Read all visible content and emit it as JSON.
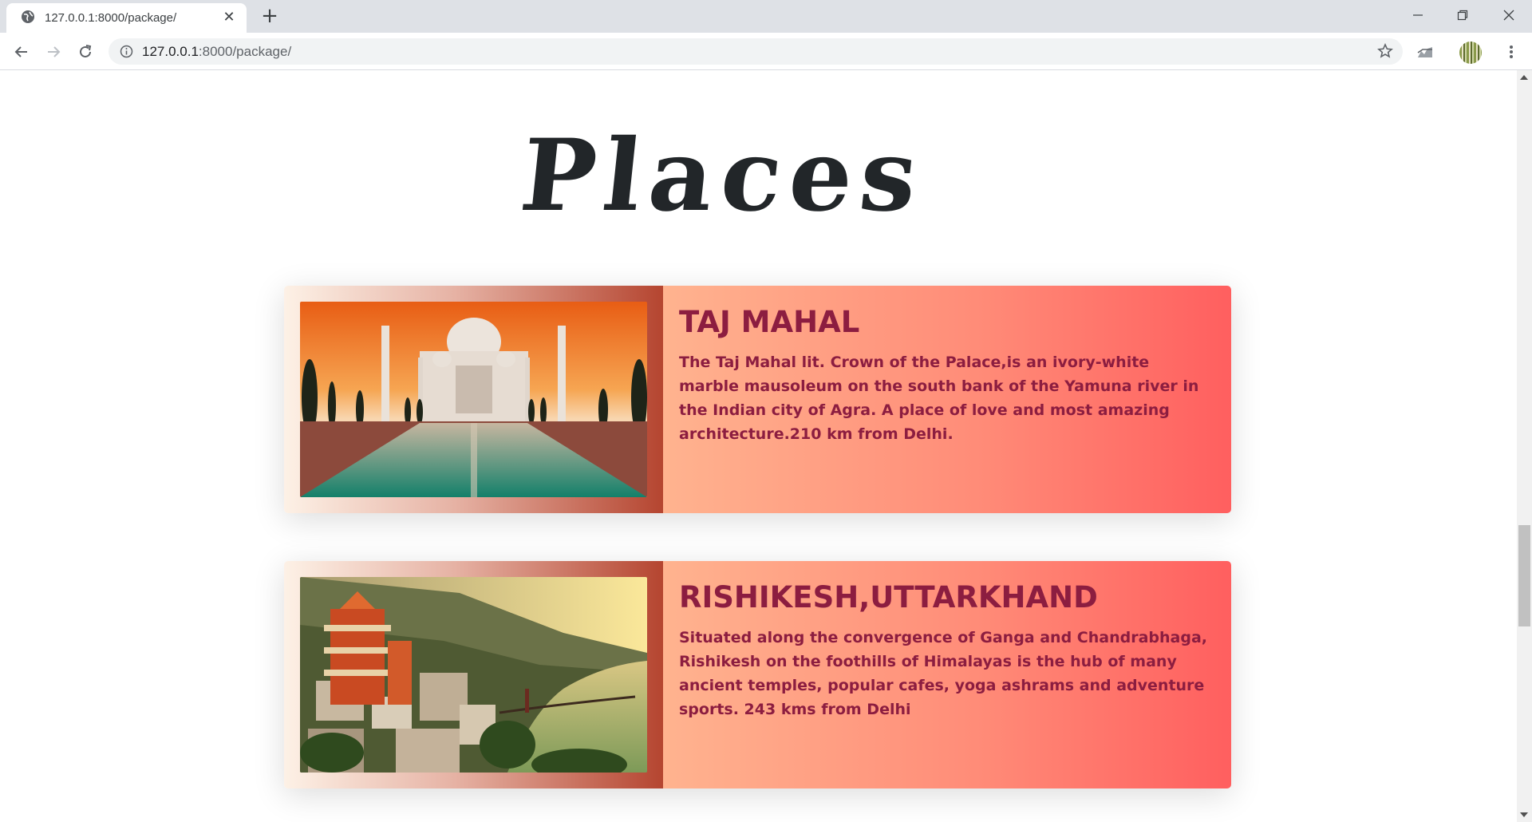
{
  "browser": {
    "tab_title": "127.0.0.1:8000/package/",
    "url_host": "127.0.0.1",
    "url_path": ":8000/package/"
  },
  "page": {
    "title": "Places",
    "places": [
      {
        "name": "TAJ MAHAL",
        "description": "The Taj Mahal lit. Crown of the Palace,is an ivory-white marble mausoleum on the south bank of the Yamuna river in the Indian city of Agra. A place of love and most amazing architecture.210 km from Delhi."
      },
      {
        "name": "RISHIKESH,UTTARKHAND",
        "description": "Situated along the convergence of Ganga and Chandrabhaga, Rishikesh on the foothills of Himalayas is the hub of many ancient temples, popular cafes, yoga ashrams and adventure sports. 243 kms from Delhi"
      }
    ]
  },
  "colors": {
    "title_text": "#222629",
    "card_text": "#8c1d40",
    "card_gradient_start": "#ffb38f",
    "card_gradient_end": "#ff5f5f"
  }
}
